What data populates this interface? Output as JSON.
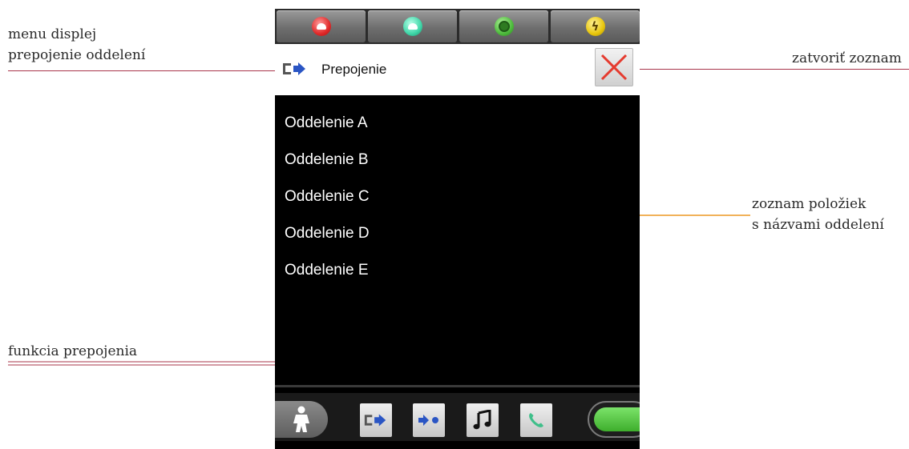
{
  "annotations": {
    "menu_display": [
      "menu displej",
      "prepojenie oddelení"
    ],
    "close_list": "zatvoriť zoznam",
    "item_list": [
      "zoznam položiek",
      "s názvami oddelení"
    ],
    "transfer_function": "funkcia prepojenia"
  },
  "device": {
    "top_buttons": [
      {
        "name": "red-call",
        "color": "#e02a2a",
        "icon": "red-lamp-icon"
      },
      {
        "name": "teal-call",
        "color": "#3fd6a8",
        "icon": "teal-lamp-icon"
      },
      {
        "name": "green-call",
        "color": "#4dbb3c",
        "icon": "green-lamp-icon"
      },
      {
        "name": "alarm",
        "color": "#e8c60c",
        "icon": "lightning-icon"
      }
    ],
    "menu_header": {
      "icon": "transfer-icon",
      "title": "Prepojenie",
      "close_icon": "close-icon"
    },
    "list_items": [
      "Oddelenie A",
      "Oddelenie B",
      "Oddelenie C",
      "Oddelenie D",
      "Oddelenie E"
    ],
    "bottom_bar": {
      "buttons": [
        "person-icon",
        "transfer-icon",
        "forward-icon",
        "music-icon",
        "phone-icon"
      ],
      "pill_color": "#4dbb3c"
    }
  },
  "colors": {
    "leader_red": "#a8344a",
    "leader_orange": "#f1b25a",
    "transfer_blue": "#2a55c4"
  }
}
